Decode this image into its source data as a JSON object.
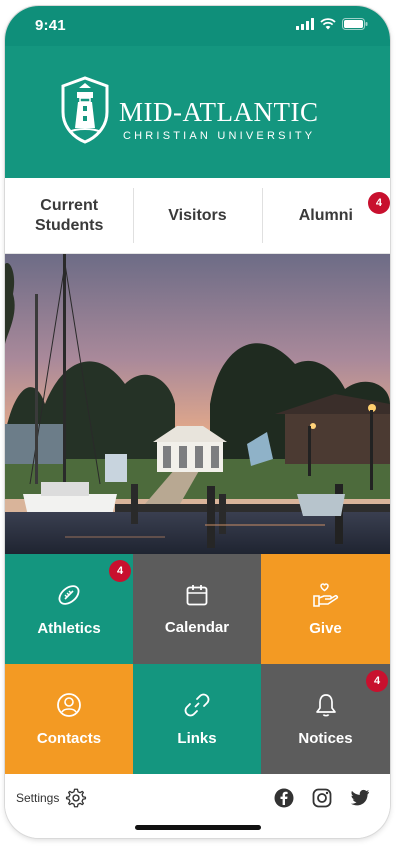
{
  "status": {
    "time": "9:41",
    "icons": [
      "signal-icon",
      "wifi-icon",
      "battery-icon"
    ]
  },
  "header": {
    "title": "MID-ATLANTIC",
    "subtitle": "CHRISTIAN UNIVERSITY",
    "logo_icon": "lighthouse-shield-icon",
    "color": "#14967f"
  },
  "tabs": [
    {
      "label_line1": "Current",
      "label_line2": "Students",
      "badge": null
    },
    {
      "label_line1": "Visitors",
      "label_line2": "",
      "badge": null
    },
    {
      "label_line1": "Alumni",
      "label_line2": "",
      "badge": "4"
    }
  ],
  "tiles": [
    {
      "label": "Athletics",
      "icon": "football-icon",
      "color": "#14967f",
      "badge": "4"
    },
    {
      "label": "Calendar",
      "icon": "calendar-icon",
      "color": "#5c5c5c",
      "badge": null
    },
    {
      "label": "Give",
      "icon": "hand-heart-icon",
      "color": "#f39a23",
      "badge": null
    },
    {
      "label": "Contacts",
      "icon": "person-icon",
      "color": "#f39a23",
      "badge": null
    },
    {
      "label": "Links",
      "icon": "link-icon",
      "color": "#14967f",
      "badge": null
    },
    {
      "label": "Notices",
      "icon": "bell-icon",
      "color": "#5c5c5c",
      "badge": "4"
    }
  ],
  "footer": {
    "settings_label": "Settings",
    "settings_icon": "gear-icon",
    "socials": [
      "facebook-icon",
      "instagram-icon",
      "twitter-icon"
    ]
  },
  "colors": {
    "teal": "#14967f",
    "gray": "#5c5c5c",
    "orange": "#f39a23",
    "badge": "#c8102e"
  }
}
